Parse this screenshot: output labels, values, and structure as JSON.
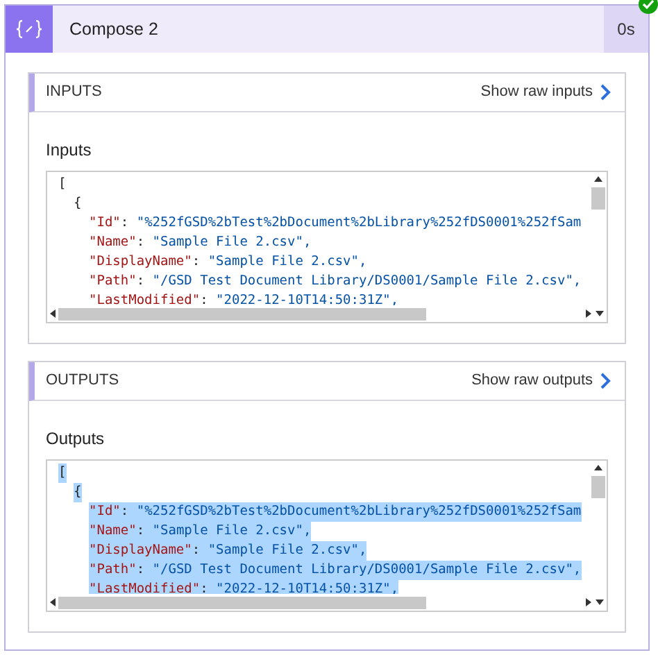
{
  "action": {
    "title": "Compose 2",
    "duration": "0s",
    "succeeded": true
  },
  "sections": [
    {
      "heading": "INPUTS",
      "raw_link": "Show raw inputs",
      "label": "Inputs",
      "selected": false,
      "code": [
        {
          "text": "[",
          "children": [
            {
              "text": "{",
              "children": [
                {
                  "key": "\"Id\"",
                  "sep": ":",
                  "value": " \"%252fGSD%2bTest%2bDocument%2bLibrary%252fDS0001%252fSam"
                },
                {
                  "key": "\"Name\"",
                  "sep": ":",
                  "value": " \"Sample File 2.csv\","
                },
                {
                  "key": "\"DisplayName\"",
                  "sep": ":",
                  "value": " \"Sample File 2.csv\","
                },
                {
                  "key": "\"Path\"",
                  "sep": ":",
                  "value": " \"/GSD Test Document Library/DS0001/Sample File 2.csv\","
                },
                {
                  "key": "\"LastModified\"",
                  "sep": ":",
                  "value": " \"2022-12-10T14:50:31Z\","
                }
              ]
            }
          ]
        }
      ]
    },
    {
      "heading": "OUTPUTS",
      "raw_link": "Show raw outputs",
      "label": "Outputs",
      "selected": true,
      "code": [
        {
          "text": "[",
          "children": [
            {
              "text": "{",
              "children": [
                {
                  "key": "\"Id\"",
                  "sep": ":",
                  "value": " \"%252fGSD%2bTest%2bDocument%2bLibrary%252fDS0001%252fSam"
                },
                {
                  "key": "\"Name\"",
                  "sep": ":",
                  "value": " \"Sample File 2.csv\","
                },
                {
                  "key": "\"DisplayName\"",
                  "sep": ":",
                  "value": " \"Sample File 2.csv\","
                },
                {
                  "key": "\"Path\"",
                  "sep": ":",
                  "value": " \"/GSD Test Document Library/DS0001/Sample File 2.csv\","
                },
                {
                  "key": "\"LastModified\"",
                  "sep": ":",
                  "value": " \"2022-12-10T14:50:31Z\","
                }
              ]
            }
          ]
        }
      ]
    }
  ]
}
